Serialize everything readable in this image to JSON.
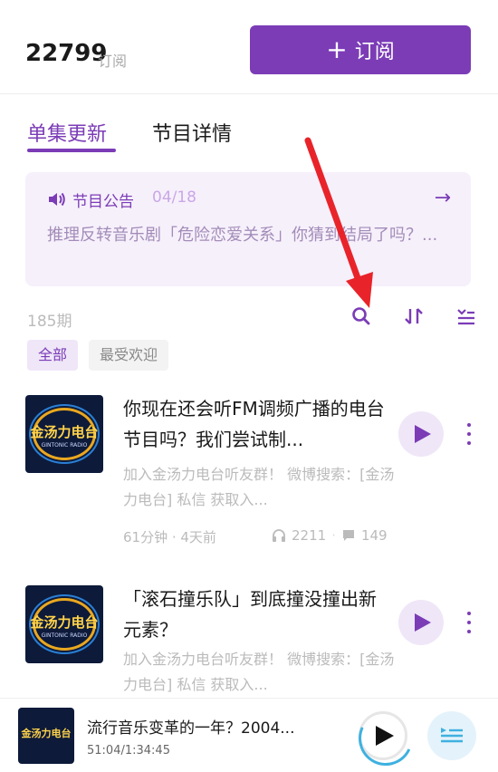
{
  "header": {
    "subscriber_count": "22799",
    "subscriber_label": "订阅",
    "subscribe_button": "订阅",
    "plus_glyph": "+"
  },
  "tabs": [
    {
      "label": "单集更新",
      "active": true
    },
    {
      "label": "节目详情",
      "active": false
    }
  ],
  "notice": {
    "icon": "speaker-icon",
    "title": "节目公告",
    "date": "04/18",
    "text": "推理反转音乐剧「危险恋爱关系」你猜到结局了吗？...",
    "arrow": "→"
  },
  "toolbar": {
    "episode_count": "185期",
    "icons": [
      "search-icon",
      "sort-icon",
      "filter-list-icon"
    ]
  },
  "filters": [
    "全部",
    "最受欢迎"
  ],
  "cover": {
    "name": "金汤力电台",
    "sub": "GINTONIC RADIO"
  },
  "episodes": [
    {
      "title": "你现在还会听FM调频广播的电台节目吗？我们尝试制...",
      "desc": "加入金汤力电台听友群！ 微博搜索：[金汤力电台] 私信 获取入...",
      "meta": "61分钟 · 4天前",
      "plays": "2211",
      "comments": "149"
    },
    {
      "title": "「滚石撞乐队」到底撞没撞出新元素？",
      "desc": "加入金汤力电台听友群！ 微博搜索：[金汤力电台] 私信 获取入..."
    }
  ],
  "player": {
    "title": "流行音乐变革的一年？2004...",
    "time": "51:04/1:34:45",
    "progress": 0.54
  },
  "colors": {
    "accent": "#7b3cb6",
    "annotation": "#e8242a",
    "player_ring": "#3fb1e0"
  }
}
